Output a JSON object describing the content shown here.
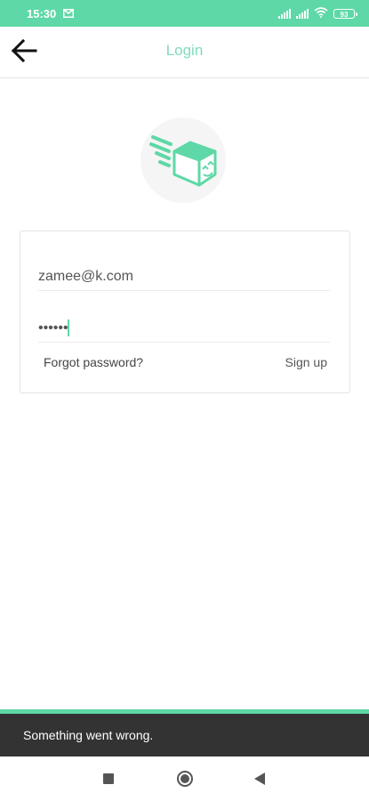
{
  "status_bar": {
    "time": "15:30",
    "notification_icon": "mail-icon",
    "battery": "93"
  },
  "app_bar": {
    "title": "Login",
    "back_icon": "arrow-left-icon"
  },
  "logo": {
    "icon": "delivery-box-icon"
  },
  "form": {
    "email_value": "zamee@k.com",
    "email_placeholder": "",
    "password_value": "••••••",
    "forgot_label": "Forgot password?",
    "signup_label": "Sign up"
  },
  "snackbar": {
    "message": "Something went wrong."
  },
  "nav": {
    "recents_icon": "square-icon",
    "home_icon": "circle-home-icon",
    "back_icon": "triangle-back-icon"
  },
  "colors": {
    "accent": "#5ed8a6",
    "title": "#7fdcbc",
    "snackbar_bg": "#333333"
  }
}
